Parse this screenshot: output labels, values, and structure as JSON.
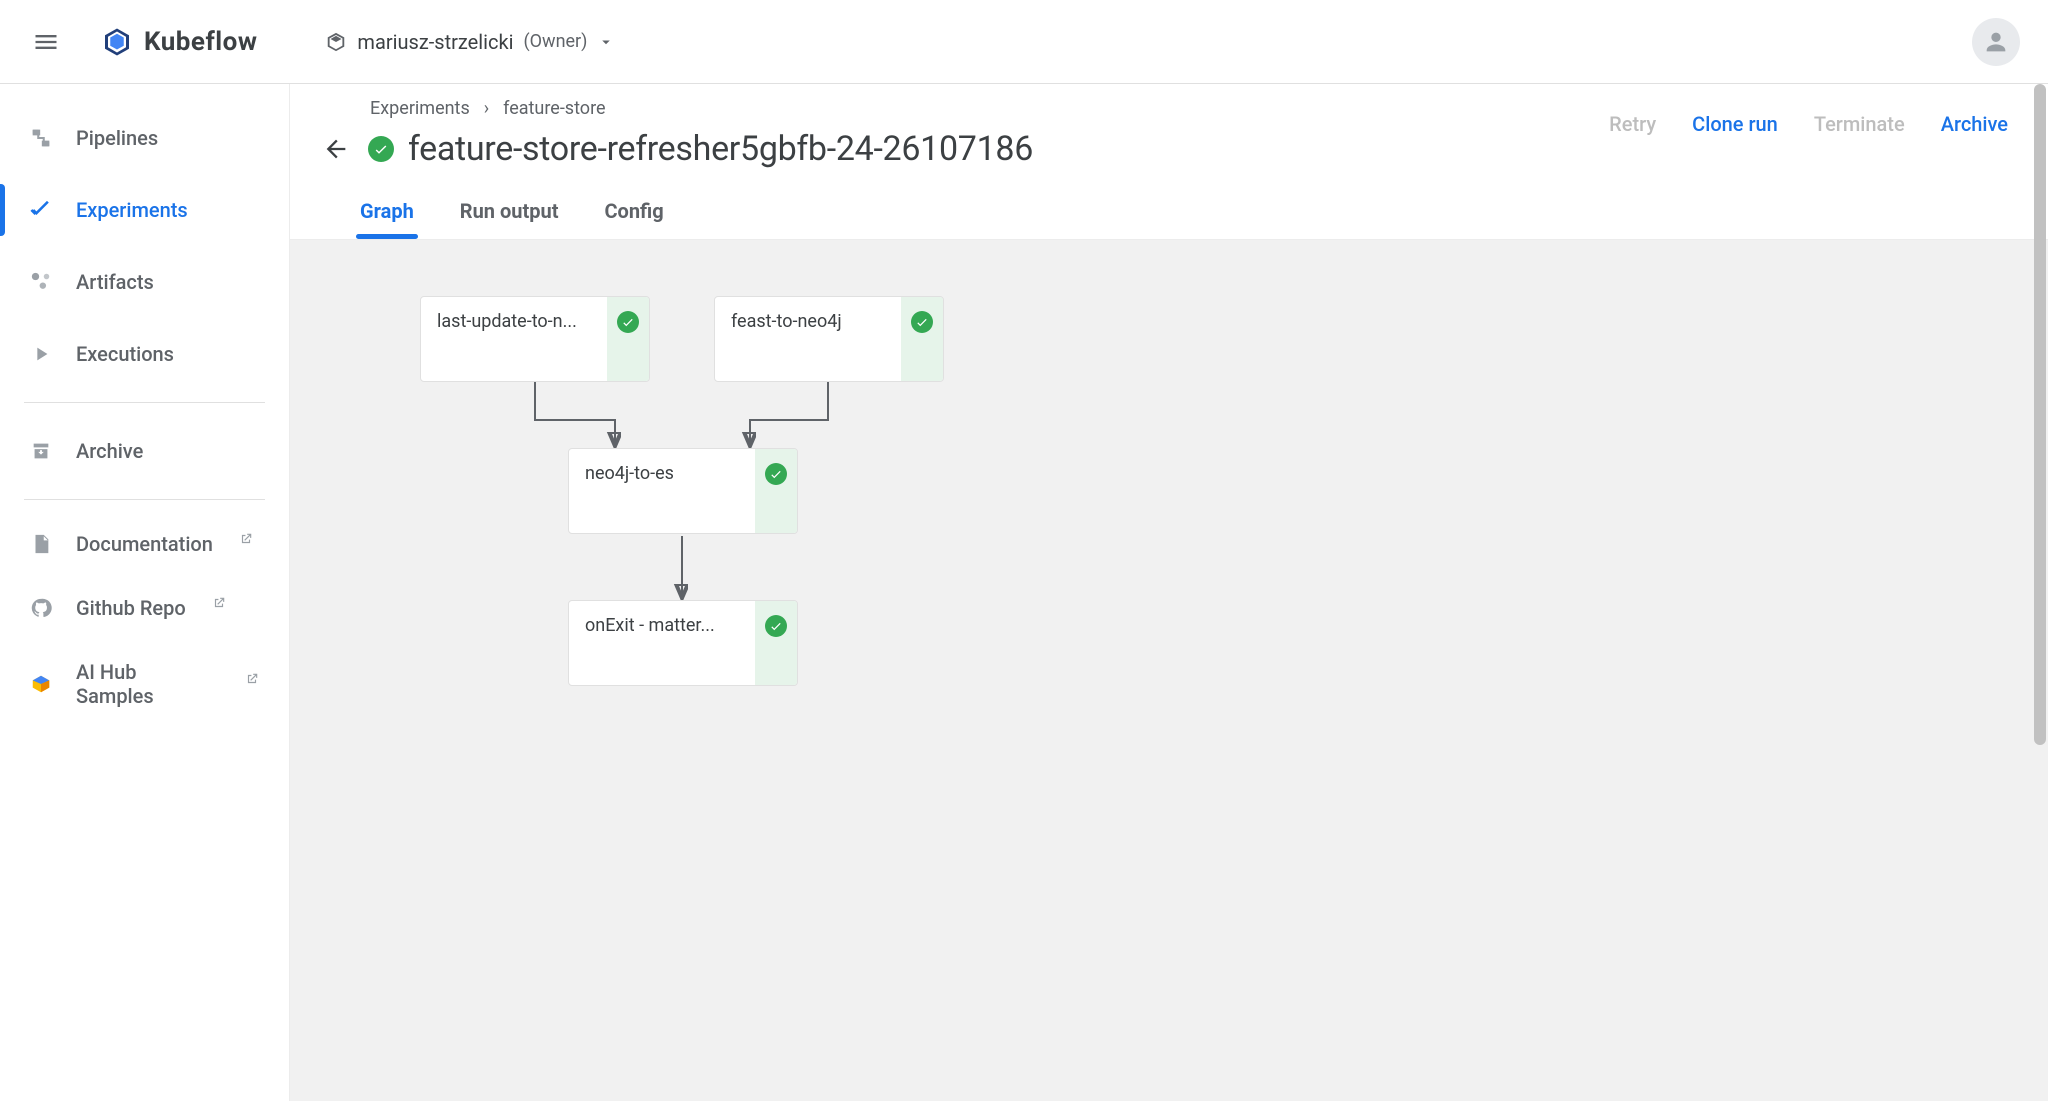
{
  "topbar": {
    "brand": "Kubeflow",
    "workspace_name": "mariusz-strzelicki",
    "workspace_role": "(Owner)"
  },
  "sidebar": {
    "items": [
      {
        "label": "Pipelines",
        "active": false
      },
      {
        "label": "Experiments",
        "active": true
      },
      {
        "label": "Artifacts",
        "active": false
      },
      {
        "label": "Executions",
        "active": false
      }
    ],
    "archive_label": "Archive",
    "links": [
      {
        "label": "Documentation"
      },
      {
        "label": "Github Repo"
      },
      {
        "label": "AI Hub Samples"
      }
    ]
  },
  "breadcrumb": {
    "root": "Experiments",
    "leaf": "feature-store"
  },
  "run": {
    "title": "feature-store-refresher5gbfb-24-26107186",
    "status": "success"
  },
  "actions": {
    "retry": "Retry",
    "clone": "Clone run",
    "terminate": "Terminate",
    "archive": "Archive"
  },
  "tabs": {
    "graph": "Graph",
    "run_output": "Run output",
    "config": "Config",
    "active": "graph"
  },
  "graph": {
    "nodes": [
      {
        "id": "last-update",
        "label": "last-update-to-n...",
        "status": "success"
      },
      {
        "id": "feast-to-neo4j",
        "label": "feast-to-neo4j",
        "status": "success"
      },
      {
        "id": "neo4j-to-es",
        "label": "neo4j-to-es",
        "status": "success"
      },
      {
        "id": "onexit",
        "label": "onExit - matter...",
        "status": "success"
      }
    ],
    "edges": [
      {
        "from": "last-update",
        "to": "neo4j-to-es"
      },
      {
        "from": "feast-to-neo4j",
        "to": "neo4j-to-es"
      },
      {
        "from": "neo4j-to-es",
        "to": "onexit"
      }
    ]
  }
}
